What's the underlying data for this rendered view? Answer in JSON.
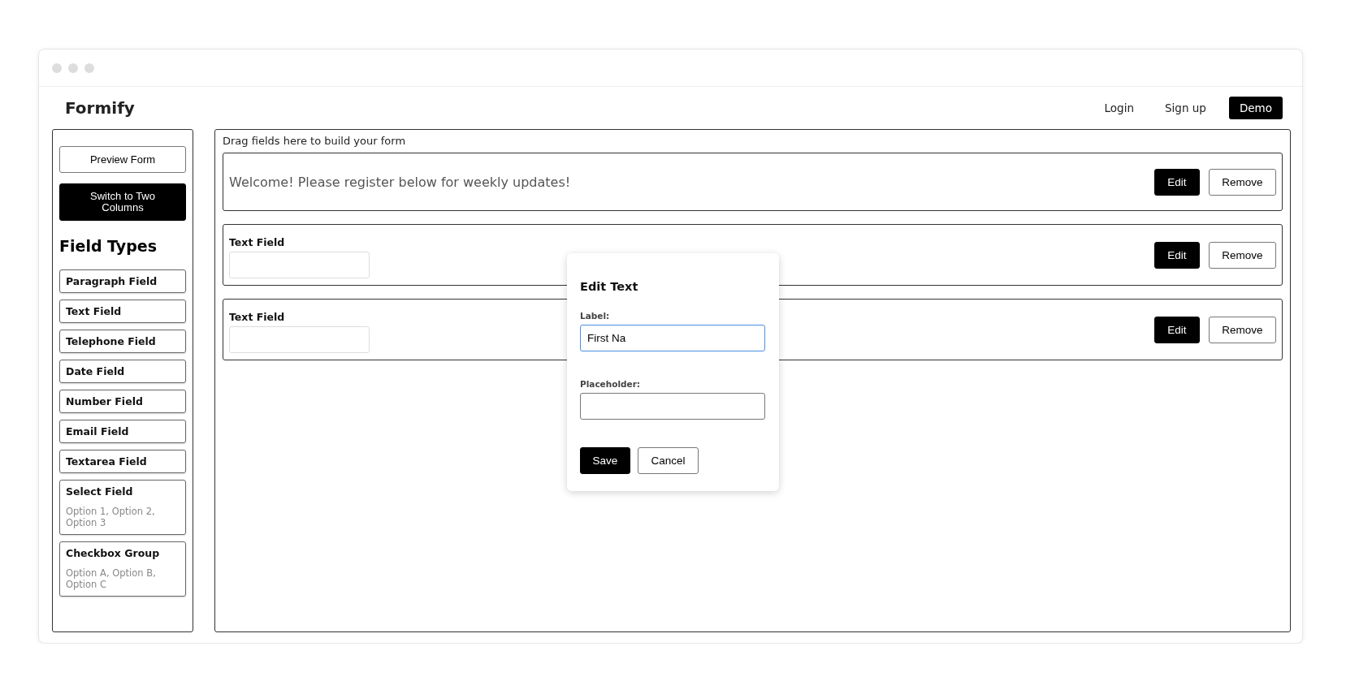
{
  "header": {
    "logo": "Formify",
    "nav": [
      {
        "label": "Login",
        "kind": "link"
      },
      {
        "label": "Sign up",
        "kind": "link"
      },
      {
        "label": "Demo",
        "kind": "button"
      }
    ]
  },
  "sidebar": {
    "actions": [
      {
        "label": "Preview Form",
        "kind": "outline"
      },
      {
        "label": "Switch to Two Columns",
        "kind": "filled"
      }
    ],
    "heading": "Field Types",
    "field_types": [
      {
        "name": "Paragraph Field"
      },
      {
        "name": "Text Field"
      },
      {
        "name": "Telephone Field"
      },
      {
        "name": "Date Field"
      },
      {
        "name": "Number Field"
      },
      {
        "name": "Email Field"
      },
      {
        "name": "Textarea Field"
      },
      {
        "name": "Select Field",
        "options": "Option 1, Option 2, Option 3"
      },
      {
        "name": "Checkbox Group",
        "options": "Option A, Option B, Option C"
      }
    ]
  },
  "canvas": {
    "hint": "Drag fields here to build your form",
    "fields": [
      {
        "kind": "paragraph",
        "text": "Welcome! Please register below for weekly updates!",
        "edit": "Edit",
        "remove": "Remove"
      },
      {
        "kind": "text",
        "label": "Text Field",
        "edit": "Edit",
        "remove": "Remove"
      },
      {
        "kind": "text",
        "label": "Text Field",
        "edit": "Edit",
        "remove": "Remove"
      }
    ]
  },
  "dialog": {
    "title": "Edit Text",
    "fields": [
      {
        "label": "Label:",
        "value": "First Na",
        "focused": true
      },
      {
        "label": "Placeholder:",
        "focused": false
      }
    ],
    "buttons": [
      {
        "label": "Save",
        "kind": "primary"
      },
      {
        "label": "Cancel",
        "kind": "secondary"
      }
    ]
  }
}
